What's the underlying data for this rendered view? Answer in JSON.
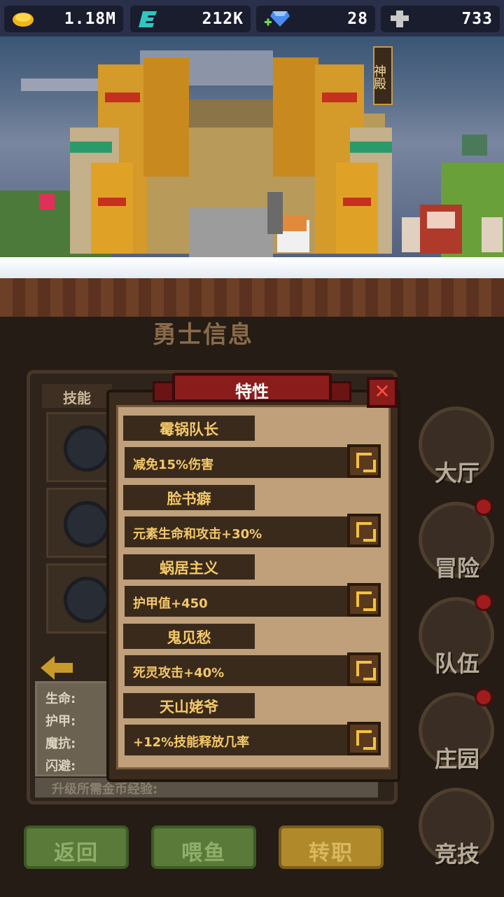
{
  "resources": {
    "gold": {
      "icon": "gold-coin-icon",
      "value": "1.18M"
    },
    "energy": {
      "icon": "energy-e-icon",
      "value": "212K"
    },
    "diamond": {
      "icon": "diamond-plus-icon",
      "value": "28"
    },
    "cross": {
      "icon": "cross-icon",
      "value": "733"
    }
  },
  "scene": {
    "temple_sign": "神殿"
  },
  "panel": {
    "title": "勇士信息",
    "skills_header": "技能",
    "stats": {
      "hp": "生命:",
      "armor": "护甲:",
      "magic_resist": "魔抗:",
      "dodge": "闪避:"
    },
    "upgrade_label": "升级所需金币经验:"
  },
  "buttons": {
    "back": "返回",
    "feed": "喂鱼",
    "reclass": "转职"
  },
  "nav": {
    "hall": "大厅",
    "adventure": "冒险",
    "team": "队伍",
    "manor": "庄园",
    "arena": "竞技"
  },
  "dialog": {
    "title": "特性",
    "close": "✕",
    "traits": [
      {
        "name": "霉锅队长",
        "desc": "减免15%伤害"
      },
      {
        "name": "脸书癖",
        "desc": "元素生命和攻击+30%"
      },
      {
        "name": "蜗居主义",
        "desc": "护甲值+450"
      },
      {
        "name": "鬼见愁",
        "desc": "死灵攻击+40%"
      },
      {
        "name": "天山姥爷",
        "desc": "+12%技能释放几率"
      }
    ]
  },
  "colors": {
    "accent_gold": "#f3c86a",
    "ribbon_red": "#8a1c1c",
    "panel_bg": "#bfa07a"
  }
}
